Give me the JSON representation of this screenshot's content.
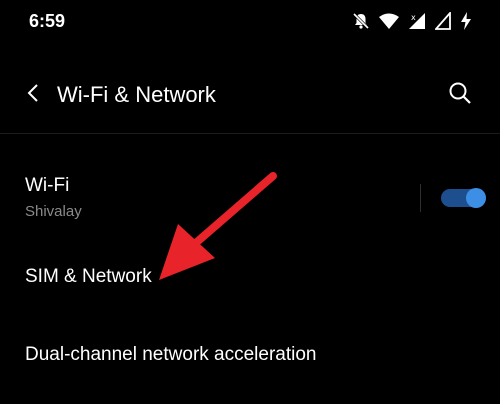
{
  "status_bar": {
    "time": "6:59",
    "icons": [
      "notifications-off-icon",
      "wifi-icon",
      "signal-x-icon",
      "signal-icon",
      "charging-icon"
    ]
  },
  "app_bar": {
    "title": "Wi-Fi & Network",
    "back_icon": "back-chevron-icon",
    "search_icon": "search-icon"
  },
  "settings": {
    "wifi": {
      "title": "Wi-Fi",
      "subtitle": "Shivalay",
      "toggle_on": true
    },
    "sim": {
      "title": "SIM & Network"
    },
    "dual_channel": {
      "title": "Dual-channel network acceleration"
    }
  },
  "annotation": {
    "arrow_color": "#e8232a"
  },
  "colors": {
    "background": "#000000",
    "toggle_track": "#1d4f8f",
    "toggle_thumb": "#3d8fe6",
    "subtitle": "#8a8a8a"
  }
}
